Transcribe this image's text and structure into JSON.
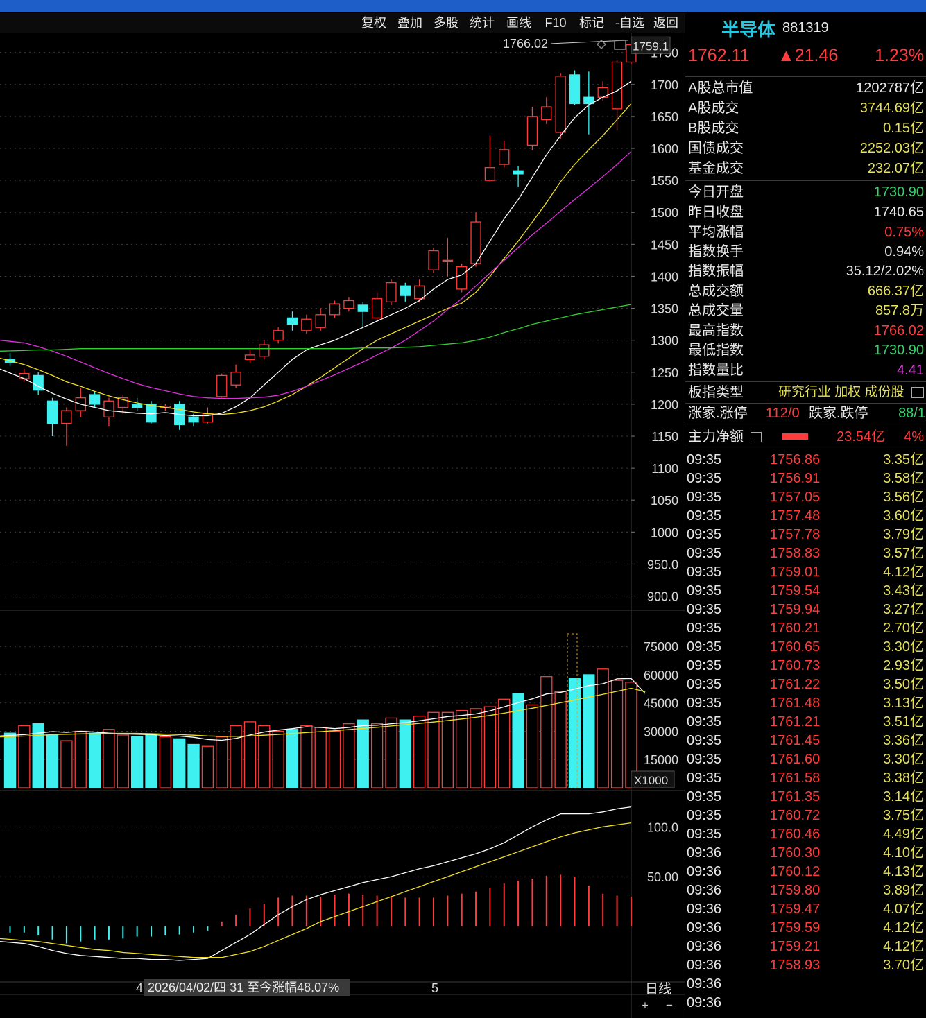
{
  "toolbar": {
    "buttons": [
      "复权",
      "叠加",
      "多股",
      "统计",
      "画线",
      "F10",
      "标记",
      "-自选",
      "返回"
    ]
  },
  "header": {
    "name": "半导体",
    "code": "881319",
    "price": "1762.11",
    "change": "▲21.46",
    "change_pct": "1.23%"
  },
  "stats": [
    {
      "label": "A股总市值",
      "value": "1202787亿",
      "color": "#e8e8e8"
    },
    {
      "label": "A股成交",
      "value": "3744.69亿",
      "color": "#e6e25c"
    },
    {
      "label": "B股成交",
      "value": "0.15亿",
      "color": "#e6e25c"
    },
    {
      "label": "国债成交",
      "value": "2252.03亿",
      "color": "#e6e25c"
    },
    {
      "label": "基金成交",
      "value": "232.07亿",
      "color": "#e6e25c"
    },
    {
      "label": "今日开盘",
      "value": "1730.90",
      "color": "#37d26a"
    },
    {
      "label": "昨日收盘",
      "value": "1740.65",
      "color": "#e8e8e8"
    },
    {
      "label": "平均涨幅",
      "value": "0.75%",
      "color": "#ff3b3b"
    },
    {
      "label": "指数换手",
      "value": "0.94%",
      "color": "#e8e8e8"
    },
    {
      "label": "指数振幅",
      "value": "35.12/2.02%",
      "color": "#e8e8e8"
    },
    {
      "label": "总成交额",
      "value": "666.37亿",
      "color": "#e6e25c"
    },
    {
      "label": "总成交量",
      "value": "857.8万",
      "color": "#e6e25c"
    },
    {
      "label": "最高指数",
      "value": "1766.02",
      "color": "#ff3b3b"
    },
    {
      "label": "最低指数",
      "value": "1730.90",
      "color": "#37d26a"
    },
    {
      "label": "指数量比",
      "value": "4.41",
      "color": "#d040d0"
    }
  ],
  "board": {
    "label": "板指类型",
    "value": "研究行业 加权 成份股"
  },
  "updown": {
    "up_label": "涨家.涨停",
    "up_value": "112/0",
    "down_label": "跌家.跌停",
    "down_value": "88/1"
  },
  "mainflow": {
    "label": "主力净额",
    "value": "23.54亿",
    "pct": "4%"
  },
  "ticks": [
    {
      "t": "09:35",
      "p": "1756.86",
      "a": "3.35亿"
    },
    {
      "t": "09:35",
      "p": "1756.91",
      "a": "3.58亿"
    },
    {
      "t": "09:35",
      "p": "1757.05",
      "a": "3.56亿"
    },
    {
      "t": "09:35",
      "p": "1757.48",
      "a": "3.60亿"
    },
    {
      "t": "09:35",
      "p": "1757.78",
      "a": "3.79亿"
    },
    {
      "t": "09:35",
      "p": "1758.83",
      "a": "3.57亿"
    },
    {
      "t": "09:35",
      "p": "1759.01",
      "a": "4.12亿"
    },
    {
      "t": "09:35",
      "p": "1759.54",
      "a": "3.43亿"
    },
    {
      "t": "09:35",
      "p": "1759.94",
      "a": "3.27亿"
    },
    {
      "t": "09:35",
      "p": "1760.21",
      "a": "2.70亿"
    },
    {
      "t": "09:35",
      "p": "1760.65",
      "a": "3.30亿"
    },
    {
      "t": "09:35",
      "p": "1760.73",
      "a": "2.93亿"
    },
    {
      "t": "09:35",
      "p": "1761.22",
      "a": "3.50亿"
    },
    {
      "t": "09:35",
      "p": "1761.48",
      "a": "3.13亿"
    },
    {
      "t": "09:35",
      "p": "1761.21",
      "a": "3.51亿"
    },
    {
      "t": "09:35",
      "p": "1761.45",
      "a": "3.36亿"
    },
    {
      "t": "09:35",
      "p": "1761.60",
      "a": "3.30亿"
    },
    {
      "t": "09:35",
      "p": "1761.58",
      "a": "3.38亿"
    },
    {
      "t": "09:35",
      "p": "1761.35",
      "a": "3.14亿"
    },
    {
      "t": "09:35",
      "p": "1760.72",
      "a": "3.75亿"
    },
    {
      "t": "09:35",
      "p": "1760.46",
      "a": "4.49亿"
    },
    {
      "t": "09:36",
      "p": "1760.30",
      "a": "4.10亿"
    },
    {
      "t": "09:36",
      "p": "1760.12",
      "a": "4.13亿"
    },
    {
      "t": "09:36",
      "p": "1759.80",
      "a": "3.89亿"
    },
    {
      "t": "09:36",
      "p": "1759.47",
      "a": "4.07亿"
    },
    {
      "t": "09:36",
      "p": "1759.59",
      "a": "4.12亿"
    },
    {
      "t": "09:36",
      "p": "1759.21",
      "a": "4.12亿"
    },
    {
      "t": "09:36",
      "p": "1758.93",
      "a": "3.70亿"
    },
    {
      "t": "09:36",
      "p": "",
      "a": ""
    },
    {
      "t": "09:36",
      "p": "",
      "a": ""
    }
  ],
  "chart_labels": {
    "price_ticks": [
      "1750",
      "1700",
      "1650",
      "1600",
      "1550",
      "1500",
      "1450",
      "1400",
      "1350",
      "1300",
      "1250",
      "1200",
      "1150",
      "1100",
      "1050",
      "1000",
      "950.0",
      "900.0"
    ],
    "volume_ticks": [
      "75000",
      "60000",
      "45000",
      "30000",
      "15000"
    ],
    "volume_unit": "X1000",
    "indicator_ticks": [
      "100.0",
      "50.00"
    ],
    "current_price_tag": "1759.1",
    "high_label": "1766.02",
    "month_4": "4",
    "cursor_info": "2026/04/02/四 31 至今涨幅48.07%",
    "month_5": "5",
    "period": "日线",
    "zoom_in": "+",
    "zoom_out": "−"
  },
  "chart_data": {
    "type": "candlestick",
    "y_range": [
      880,
      1780
    ],
    "candles": [
      [
        1270,
        1265,
        1280,
        1260
      ],
      [
        1240,
        1248,
        1255,
        1235
      ],
      [
        1245,
        1222,
        1250,
        1215
      ],
      [
        1205,
        1170,
        1210,
        1150
      ],
      [
        1170,
        1190,
        1195,
        1135
      ],
      [
        1190,
        1210,
        1225,
        1180
      ],
      [
        1215,
        1200,
        1220,
        1195
      ],
      [
        1180,
        1205,
        1210,
        1165
      ],
      [
        1195,
        1210,
        1215,
        1185
      ],
      [
        1200,
        1195,
        1210,
        1190
      ],
      [
        1200,
        1172,
        1205,
        1170
      ],
      [
        1195,
        1197,
        1200,
        1190
      ],
      [
        1200,
        1168,
        1205,
        1160
      ],
      [
        1180,
        1172,
        1185,
        1165
      ],
      [
        1172,
        1185,
        1195,
        1170
      ],
      [
        1212,
        1245,
        1248,
        1210
      ],
      [
        1230,
        1250,
        1262,
        1225
      ],
      [
        1270,
        1277,
        1285,
        1265
      ],
      [
        1275,
        1293,
        1300,
        1270
      ],
      [
        1300,
        1315,
        1320,
        1295
      ],
      [
        1335,
        1325,
        1345,
        1315
      ],
      [
        1315,
        1333,
        1340,
        1310
      ],
      [
        1320,
        1340,
        1350,
        1315
      ],
      [
        1340,
        1357,
        1362,
        1335
      ],
      [
        1350,
        1362,
        1367,
        1345
      ],
      [
        1355,
        1345,
        1360,
        1320
      ],
      [
        1335,
        1365,
        1375,
        1330
      ],
      [
        1360,
        1390,
        1395,
        1355
      ],
      [
        1385,
        1370,
        1390,
        1360
      ],
      [
        1365,
        1385,
        1395,
        1360
      ],
      [
        1410,
        1440,
        1445,
        1405
      ],
      [
        1425,
        1425,
        1460,
        1400
      ],
      [
        1380,
        1415,
        1420,
        1375
      ],
      [
        1420,
        1485,
        1500,
        1415
      ],
      [
        1550,
        1570,
        1620,
        1548
      ],
      [
        1575,
        1598,
        1612,
        1570
      ],
      [
        1565,
        1560,
        1572,
        1540
      ],
      [
        1605,
        1650,
        1665,
        1597
      ],
      [
        1645,
        1665,
        1680,
        1638
      ],
      [
        1625,
        1713,
        1718,
        1615
      ],
      [
        1715,
        1670,
        1722,
        1668
      ],
      [
        1680,
        1670,
        1720,
        1622
      ],
      [
        1680,
        1695,
        1705,
        1675
      ],
      [
        1662,
        1735,
        1738,
        1628
      ],
      [
        1735,
        1762,
        1766,
        1731
      ]
    ],
    "ma": {
      "white": [
        1255,
        1240,
        1228,
        1217,
        1208,
        1200,
        1195,
        1190,
        1188,
        1186,
        1185,
        1187,
        1184,
        1182,
        1182,
        1186,
        1196,
        1210,
        1230,
        1250,
        1270,
        1285,
        1293,
        1300,
        1310,
        1320,
        1330,
        1340,
        1350,
        1362,
        1380,
        1395,
        1402,
        1420,
        1455,
        1490,
        1520,
        1555,
        1590,
        1620,
        1648,
        1668,
        1680,
        1690,
        1705
      ],
      "yellow": [
        1272,
        1262,
        1254,
        1245,
        1235,
        1228,
        1220,
        1213,
        1207,
        1202,
        1198,
        1195,
        1192,
        1188,
        1185,
        1184,
        1186,
        1190,
        1196,
        1205,
        1215,
        1228,
        1242,
        1257,
        1272,
        1287,
        1300,
        1310,
        1320,
        1330,
        1340,
        1350,
        1358,
        1375,
        1400,
        1428,
        1455,
        1485,
        1515,
        1548,
        1575,
        1598,
        1620,
        1645,
        1670
      ],
      "magenta": [
        1300,
        1296,
        1290,
        1283,
        1275,
        1266,
        1257,
        1248,
        1240,
        1232,
        1226,
        1221,
        1216,
        1212,
        1210,
        1209,
        1209,
        1210,
        1211,
        1214,
        1220,
        1228,
        1237,
        1246,
        1256,
        1266,
        1277,
        1288,
        1300,
        1315,
        1330,
        1348,
        1365,
        1385,
        1405,
        1425,
        1445,
        1465,
        1483,
        1502,
        1520,
        1538,
        1556,
        1575,
        1595
      ],
      "green": [
        1283,
        1284,
        1285,
        1285,
        1286,
        1287,
        1287,
        1287,
        1287,
        1287,
        1287,
        1287,
        1287,
        1287,
        1287,
        1287,
        1287,
        1287,
        1287,
        1287,
        1287,
        1287,
        1287,
        1287,
        1287,
        1288,
        1288,
        1288,
        1289,
        1290,
        1292,
        1294,
        1296,
        1300,
        1305,
        1312,
        1318,
        1325,
        1330,
        1335,
        1340,
        1344,
        1348,
        1352,
        1356
      ]
    },
    "volume_range": [
      0,
      92000
    ],
    "volume": [
      29000,
      33000,
      34000,
      28000,
      25000,
      30000,
      29000,
      31000,
      28000,
      27000,
      28000,
      27000,
      26000,
      23000,
      22000,
      27000,
      33000,
      35000,
      33000,
      30000,
      31000,
      33000,
      32000,
      30000,
      34000,
      36000,
      34000,
      37000,
      36000,
      38000,
      40000,
      40000,
      41000,
      42000,
      43000,
      47000,
      50000,
      44000,
      59000,
      51000,
      58000,
      60000,
      63000,
      57000,
      56000,
      8500
    ],
    "vol_ma": [
      [
        27500,
        28200,
        29000,
        29800,
        29400,
        30000,
        29600,
        29000,
        28600,
        28400,
        28200,
        27800,
        27400,
        26800,
        25600,
        25200,
        26200,
        28000,
        29600,
        30600,
        31400,
        32400,
        32000,
        31400,
        32000,
        33000,
        33200,
        34000,
        34600,
        35600,
        36600,
        37800,
        38400,
        39200,
        40800,
        43000,
        45200,
        47200,
        49800,
        50600,
        52400,
        54200,
        55200,
        57800,
        58000,
        50000
      ],
      [
        27000,
        27400,
        27800,
        28200,
        28400,
        28600,
        28800,
        28900,
        28900,
        28900,
        28700,
        28500,
        28200,
        27900,
        27500,
        27300,
        27300,
        27500,
        27900,
        28300,
        28800,
        29300,
        29800,
        30300,
        30900,
        31500,
        32100,
        32800,
        33500,
        34200,
        34900,
        35700,
        36500,
        37400,
        38400,
        39600,
        40900,
        42200,
        43700,
        45100,
        46600,
        48100,
        49600,
        51200,
        52800,
        51000
      ]
    ],
    "macd_range": [
      -50,
      135
    ],
    "macd_dif": [
      -15,
      -17,
      -20,
      -24,
      -27,
      -29,
      -30,
      -31,
      -32,
      -32,
      -33,
      -33,
      -34,
      -33,
      -32,
      -24,
      -16,
      -8,
      2,
      12,
      20,
      27,
      32,
      36,
      40,
      44,
      47,
      50,
      54,
      58,
      61,
      65,
      69,
      73,
      78,
      84,
      92,
      100,
      107,
      113,
      113,
      113,
      115,
      118,
      120
    ],
    "macd_dea": [
      -12,
      -14,
      -15,
      -17,
      -19,
      -21,
      -23,
      -24,
      -26,
      -27,
      -28,
      -29,
      -30,
      -31,
      -31,
      -31,
      -28,
      -25,
      -20,
      -14,
      -8,
      -2,
      5,
      10,
      15,
      20,
      25,
      30,
      35,
      40,
      45,
      50,
      55,
      60,
      65,
      70,
      75,
      80,
      85,
      90,
      94,
      97,
      100,
      102,
      104
    ],
    "macd_hist": [
      -6,
      -6,
      -9,
      -13,
      -17,
      -15,
      -13,
      -13,
      -12,
      -10,
      -10,
      -9,
      -8,
      -6,
      -4,
      5,
      12,
      18,
      23,
      29,
      31,
      31,
      30,
      32,
      33,
      32,
      31,
      30,
      29,
      29,
      29,
      31,
      33,
      35,
      39,
      43,
      46,
      48,
      51,
      52,
      50,
      41,
      33,
      31,
      30
    ]
  }
}
